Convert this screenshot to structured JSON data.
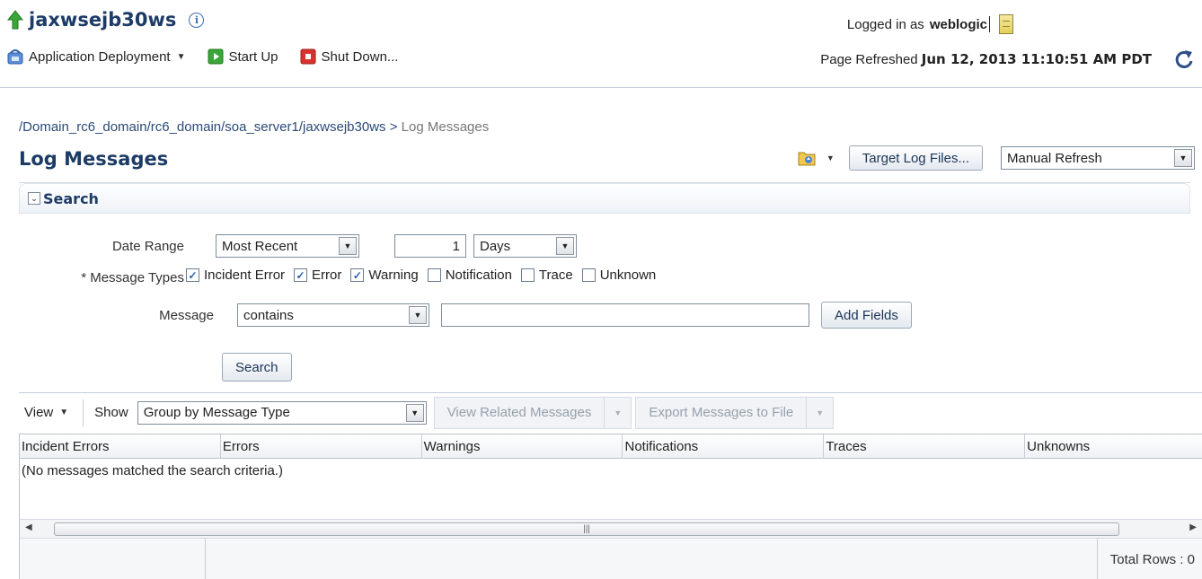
{
  "header": {
    "app_title": "jaxwsejb30ws",
    "logged_in_label": "Logged in as",
    "user": "weblogic",
    "menu": {
      "deployment": "Application Deployment",
      "start_up": "Start Up",
      "shut_down": "Shut Down..."
    },
    "page_refreshed_label": "Page Refreshed",
    "page_refreshed_time": "Jun 12, 2013 11:10:51 AM PDT"
  },
  "breadcrumb": {
    "path": "/Domain_rc6_domain/rc6_domain/soa_server1/jaxwsejb30ws",
    "separator": ">",
    "current": "Log Messages"
  },
  "page_title": "Log Messages",
  "toolbar": {
    "target_log_files": "Target Log Files...",
    "refresh_mode": "Manual Refresh"
  },
  "search": {
    "heading": "Search",
    "date_range_label": "Date Range",
    "date_range_value": "Most Recent",
    "date_count": "1",
    "date_unit": "Days",
    "message_types_label": "* Message Types",
    "message_types": [
      {
        "label": "Incident Error",
        "checked": true
      },
      {
        "label": "Error",
        "checked": true
      },
      {
        "label": "Warning",
        "checked": true
      },
      {
        "label": "Notification",
        "checked": false
      },
      {
        "label": "Trace",
        "checked": false
      },
      {
        "label": "Unknown",
        "checked": false
      }
    ],
    "message_label": "Message",
    "message_operator": "contains",
    "message_value": "",
    "add_fields": "Add Fields",
    "search_button": "Search"
  },
  "results": {
    "view_label": "View",
    "show_label": "Show",
    "show_value": "Group by Message Type",
    "view_related": "View Related Messages",
    "export": "Export Messages to File",
    "columns": [
      "Incident Errors",
      "Errors",
      "Warnings",
      "Notifications",
      "Traces",
      "Unknowns"
    ],
    "empty_text": "(No messages matched the search criteria.)",
    "total_rows_label": "Total Rows :",
    "total_rows": "0"
  },
  "colors": {
    "title": "#1c3b66",
    "link": "#2a4a78",
    "start_icon": "#3aa63a",
    "stop_icon": "#d9322e"
  },
  "icons": [
    "up-arrow-icon",
    "info-icon",
    "deployment-icon",
    "start-icon",
    "stop-icon",
    "log-icon",
    "refresh-icon",
    "folder-icon",
    "disclosure-icon",
    "checkbox-icon"
  ]
}
